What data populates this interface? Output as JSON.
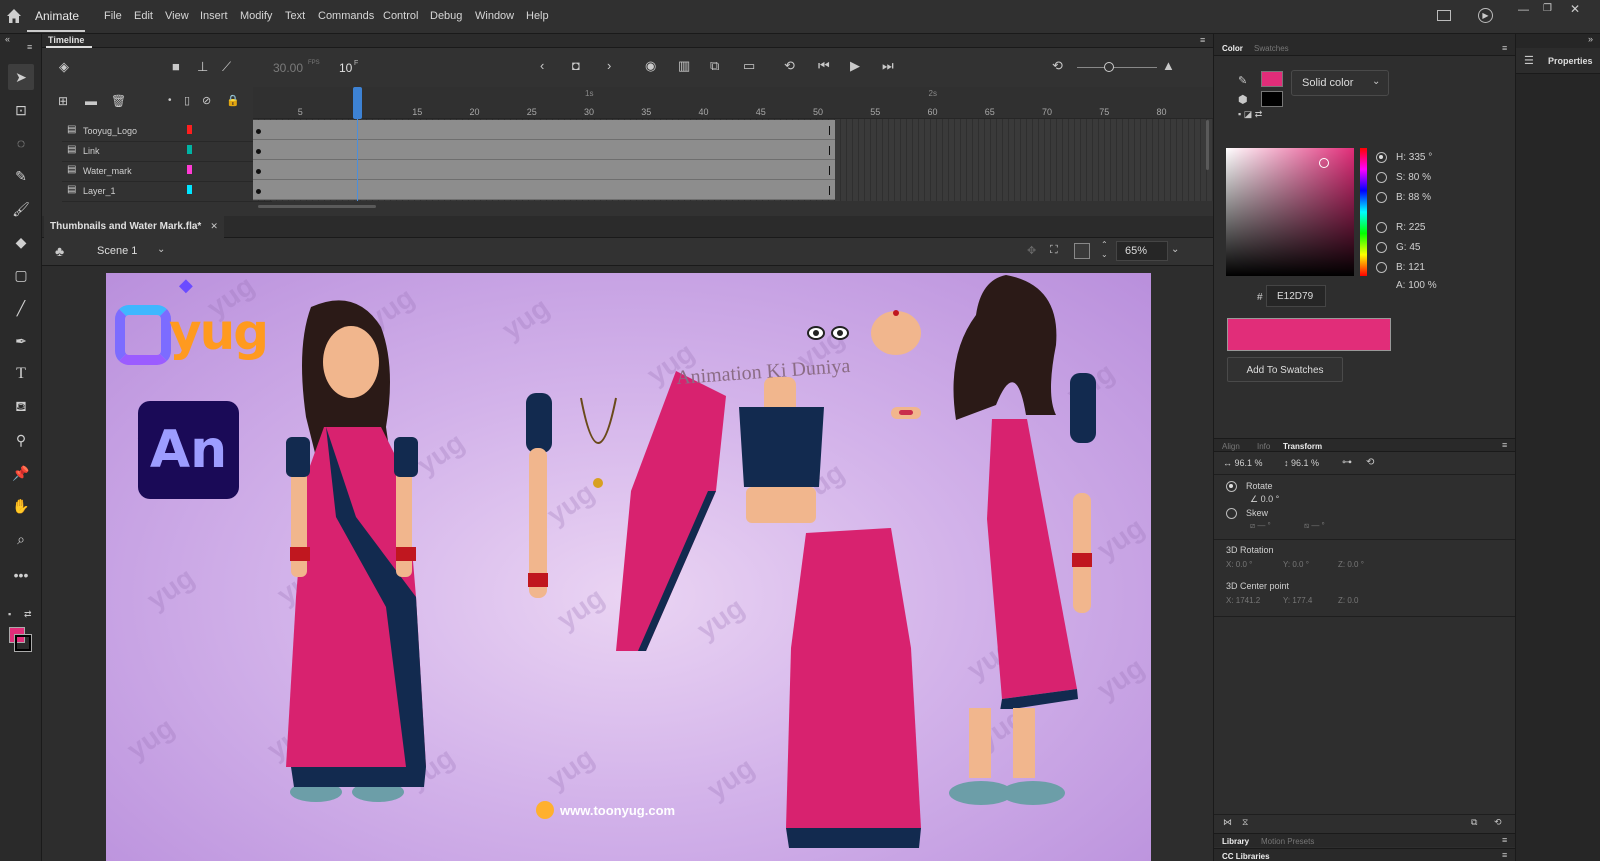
{
  "app": {
    "name": "Animate"
  },
  "menu": [
    "File",
    "Edit",
    "View",
    "Insert",
    "Modify",
    "Text",
    "Commands",
    "Control",
    "Debug",
    "Window",
    "Help"
  ],
  "timeline": {
    "panel_title": "Timeline",
    "fps": "30.00",
    "fps_unit": "FPS",
    "current_frame": "10",
    "frame_unit": "F",
    "ruler_numbers": [
      "5",
      "15",
      "20",
      "25",
      "30",
      "35",
      "40",
      "45",
      "50",
      "55",
      "60",
      "65",
      "70",
      "75",
      "80"
    ],
    "seconds_markers": [
      "1s",
      "2s"
    ],
    "layers": [
      {
        "name": "Tooyug_Logo",
        "color": "#ff1e1e"
      },
      {
        "name": "Link",
        "color": "#00b3a4"
      },
      {
        "name": "Water_mark",
        "color": "#ff3bd4"
      },
      {
        "name": "Layer_1",
        "color": "#00e5ff"
      }
    ]
  },
  "document": {
    "tab": "Thumbnails and Water Mark.fla*",
    "scene": "Scene 1",
    "zoom": "65%"
  },
  "stage": {
    "logo_text": "yug",
    "an_badge": "An",
    "caption": "Animation Ki Duniya",
    "url": "www.toonyug.com",
    "watermark": "yug"
  },
  "color_panel": {
    "tabs": [
      "Color",
      "Swatches"
    ],
    "fill_type": "Solid color",
    "stroke_color": "#e12d79",
    "fill_color": "#000000",
    "hsb": {
      "H": "335 °",
      "S": "80 %",
      "B": "88 %"
    },
    "rgb": {
      "R": "225",
      "G": "45",
      "B": "121",
      "A": "100 %"
    },
    "hex_label": "#",
    "hex": "E12D79",
    "preview_color": "#E12D79",
    "add_button": "Add To Swatches"
  },
  "transform_panel": {
    "tabs": [
      "Align",
      "Info",
      "Transform"
    ],
    "width_pct": "96.1 %",
    "height_pct": "96.1 %",
    "rotate_label": "Rotate",
    "rotate_value": "0.0 °",
    "skew_label": "Skew",
    "skew_h": "— °",
    "skew_v": "— °",
    "rotation3d_label": "3D Rotation",
    "rot3d": {
      "X": "0.0 °",
      "Y": "0.0 °",
      "Z": "0.0 °"
    },
    "center3d_label": "3D Center point",
    "center3d": {
      "X": "1741.2",
      "Y": "177.4",
      "Z": "0.0"
    }
  },
  "library_panel": {
    "tabs": [
      "Library",
      "Motion Presets"
    ],
    "cc": "CC Libraries"
  },
  "properties_label": "Properties"
}
